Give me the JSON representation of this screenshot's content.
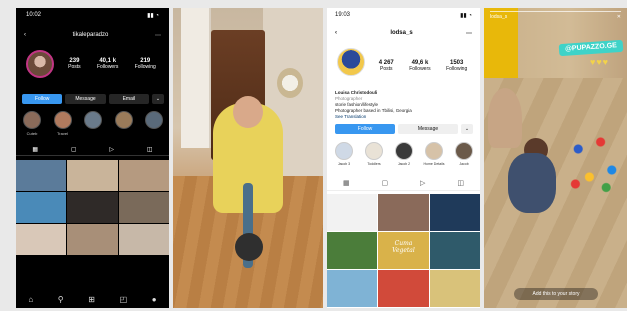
{
  "panel1": {
    "status_time": "10:02",
    "username": "tikaleparadzo",
    "stats": [
      {
        "value": "239",
        "label": "Posts"
      },
      {
        "value": "40,1 k",
        "label": "Followers"
      },
      {
        "value": "219",
        "label": "Following"
      }
    ],
    "buttons": {
      "follow": "Follow",
      "message": "Message",
      "email": "Email"
    },
    "highlights": [
      "Cuteb",
      "Travel",
      "",
      "",
      ""
    ]
  },
  "panel3": {
    "status_time": "19:03",
    "username": "lodsa_s",
    "stats": [
      {
        "value": "4 267",
        "label": "Posts"
      },
      {
        "value": "49,6 k",
        "label": "Followers"
      },
      {
        "value": "1503",
        "label": "Following"
      }
    ],
    "bio": {
      "name": "Louisa Christodouli",
      "category": "Photographer",
      "tagline": "storie fashion/lifestyle",
      "location": "Photographer based in Tbilisi, Georgia",
      "link": "See Translation"
    },
    "buttons": {
      "follow": "Follow",
      "message": "Message"
    },
    "highlights": [
      "Jacob 3",
      "Toddlers",
      "Jacob 2",
      "Home Details",
      "Jacob"
    ],
    "grid_text": "Cuma\nVegetal"
  },
  "panel4": {
    "story_user": "lodsa_s",
    "sticker": "@PUPAZZO.GE",
    "hearts": "♥♥♥",
    "add_story": "Add this to your story"
  }
}
